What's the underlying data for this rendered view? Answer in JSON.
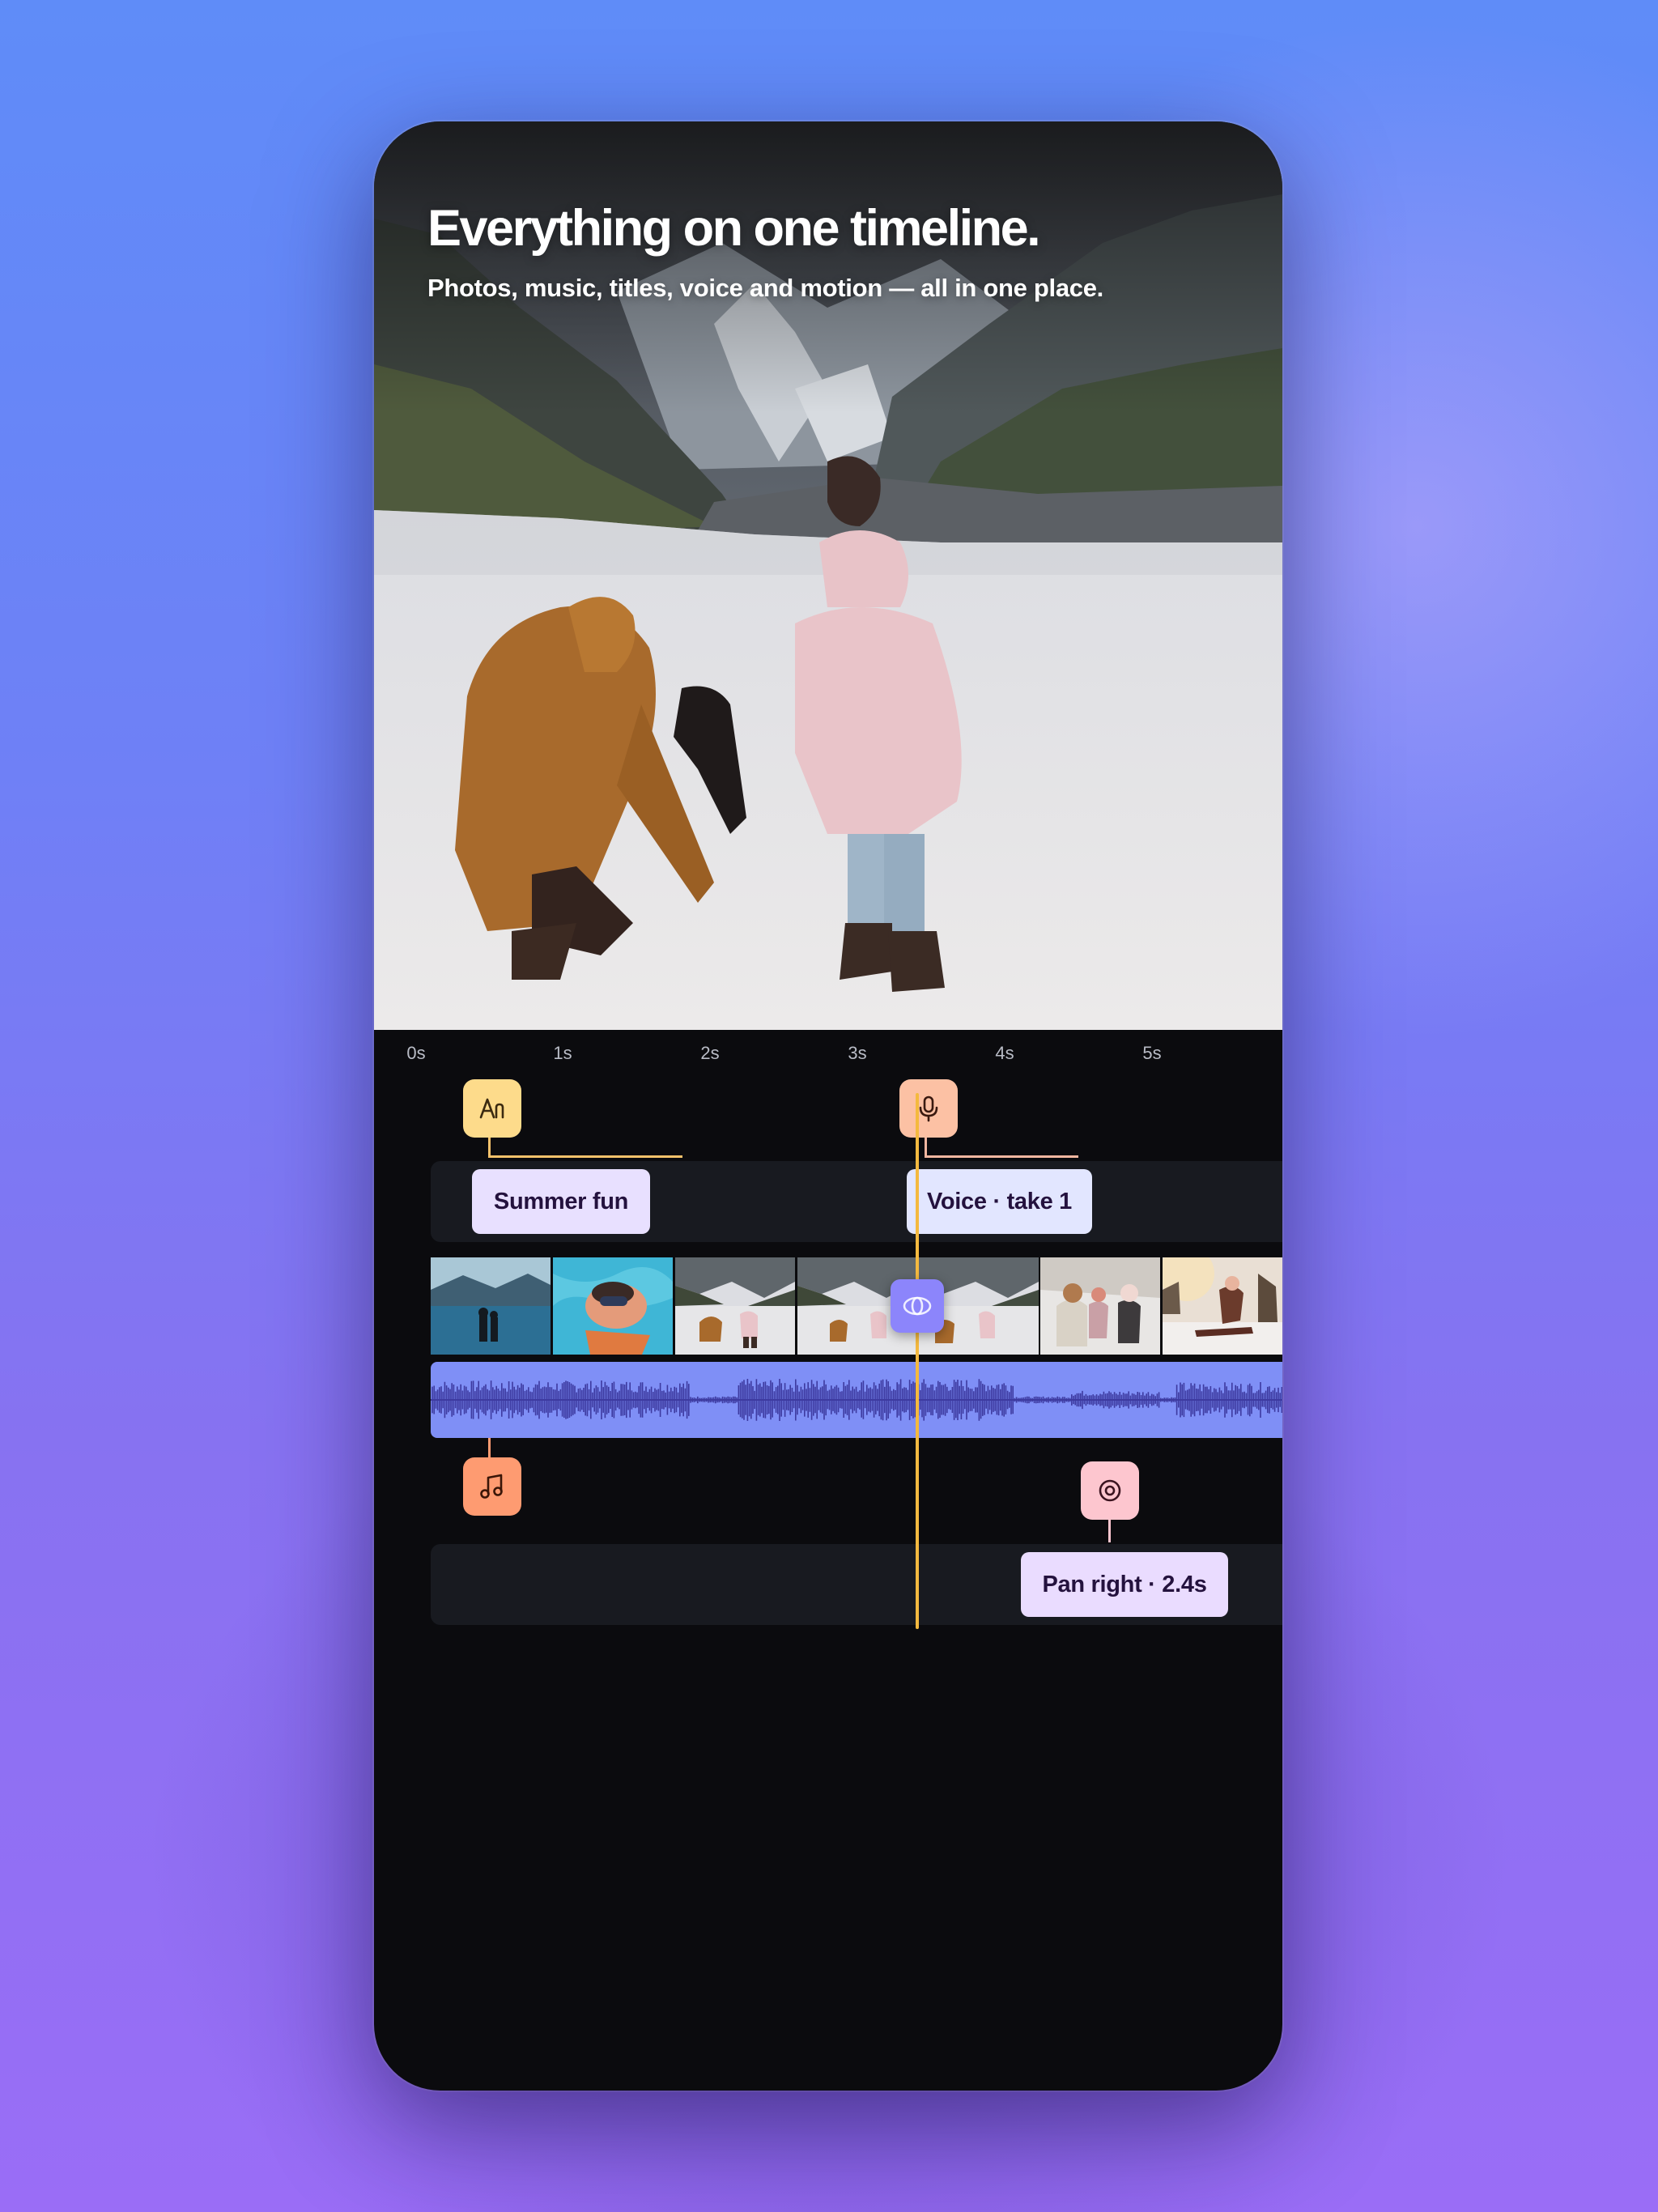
{
  "hero": {
    "title": "Everything on one timeline.",
    "subtitle": "Photos, music, titles, voice and motion — all in one place."
  },
  "timeline": {
    "ruler": [
      "0s",
      "1s",
      "2s",
      "3s",
      "4s",
      "5s"
    ],
    "markers": [
      {
        "icon": "text-icon",
        "color": "#fddb8b"
      },
      {
        "icon": "microphone-icon",
        "color": "#fcc1a4"
      },
      {
        "icon": "music-note-icon",
        "color": "#fe9b71"
      },
      {
        "icon": "target-icon",
        "color": "#fdc6cf"
      }
    ],
    "clips": {
      "title_clip": "Summer fun",
      "voice_clip": "Voice · take 1",
      "motion_clip": "Pan right · 2.4s"
    },
    "thumbnails": [
      "lake-people",
      "swimmer",
      "snow-kids",
      "snow-kids",
      "kids-winter",
      "sled-kid"
    ],
    "playhead_icon": "eye-icon",
    "colors": {
      "playhead": "#f4b93f",
      "audio_track": "#7f8ff6",
      "waveform": "#3d3aa0",
      "label_bg": "#e8e0ff"
    }
  }
}
